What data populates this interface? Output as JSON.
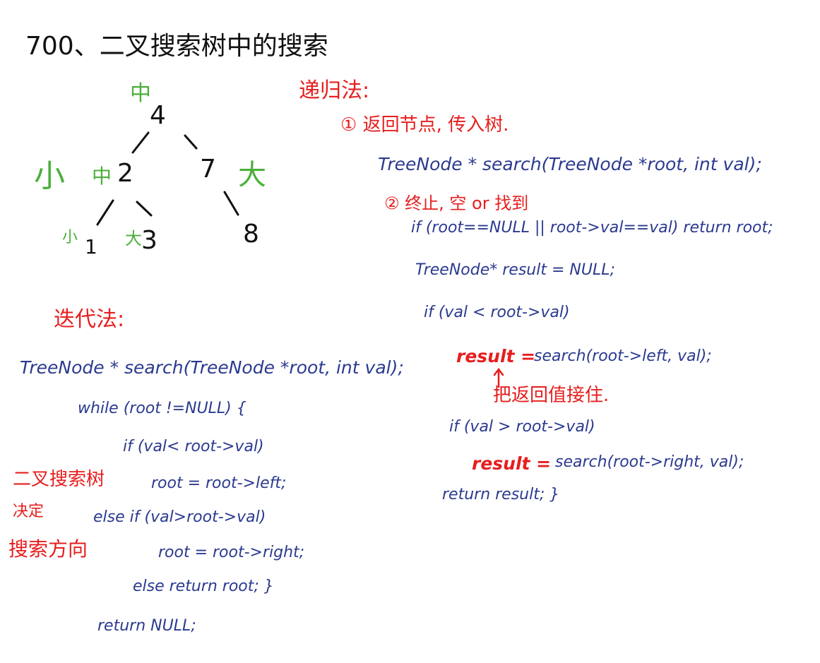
{
  "title": "700、二叉搜索树中的搜索",
  "tree": {
    "nodes": [
      "4",
      "2",
      "7",
      "1",
      "3",
      "8"
    ],
    "labels": {
      "root_mid": "中",
      "left_small": "小",
      "left_mid": "中",
      "right_big": "大",
      "small_1": "小",
      "big_3": "大"
    }
  },
  "recursive": {
    "heading": "递归法:",
    "step1": "① 返回节点, 传入树.",
    "signature": "TreeNode * search(TreeNode *root, int val);",
    "step2": "② 终止, 空 or 找到",
    "terminate": "if (root==NULL || root->val==val) return root;",
    "result_decl": "TreeNode* result = NULL;",
    "if_left": "if (val < root->val)",
    "left_result_kw": "result =",
    "left_call": "search(root->left, val);",
    "arrow_note": "把返回值接住.",
    "if_right": "if (val > root->val)",
    "right_result_kw": "result =",
    "right_call": "search(root->right, val);",
    "return_stmt": "return result; }"
  },
  "iterative": {
    "heading": "迭代法:",
    "signature": "TreeNode * search(TreeNode *root, int val);",
    "while": "while (root !=NULL) {",
    "if_left": "if (val< root->val)",
    "go_left": "root = root->left;",
    "else_if": "else if (val>root->val)",
    "go_right": "root = root->right;",
    "else_ret": "else return root; }",
    "ret_null": "return NULL;",
    "note_line1": "二叉搜索树",
    "note_line2": "决定",
    "note_line3": "搜索方向"
  },
  "colors": {
    "ink": "#111111",
    "green": "#4caf3c",
    "red": "#e61e1e",
    "blue": "#2b3a8f"
  }
}
